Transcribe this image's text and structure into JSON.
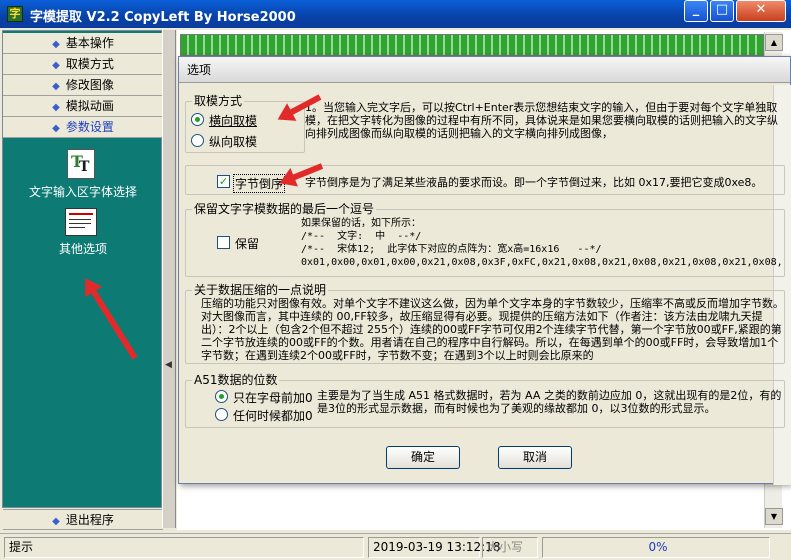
{
  "window": {
    "title": "字模提取 V2.2  CopyLeft By Horse2000",
    "icon": "app-icon"
  },
  "nav": {
    "items": [
      "基本操作",
      "取模方式",
      "修改图像",
      "模拟动画",
      "参数设置"
    ],
    "active_index": 4,
    "tools": [
      {
        "label": "文字输入区字体选择",
        "icon": "font-icon"
      },
      {
        "label": "其他选项",
        "icon": "options-icon"
      }
    ],
    "exit": "退出程序"
  },
  "dialog": {
    "title": "选项",
    "mode": {
      "title": "取模方式",
      "horizontal": "横向取模",
      "vertical": "纵向取模",
      "selected": "横向取模",
      "desc": "1。当您输入完文字后，可以按Ctrl+Enter表示您想结束文字的输入，但由于要对每个文字单独取模，在把文字转化为图像的过程中有所不同，具体说来是如果您要横向取模的话则把输入的文字纵向排列成图像而纵向取模的话则把输入的文字横向排列成图像，"
    },
    "byte_reverse": {
      "label": "字节倒序",
      "checked": true,
      "desc": "字节倒序是为了满足某些液晶的要求而设。即一个字节倒过来，比如 0x17,要把它变成0xe8。"
    },
    "keep_comma": {
      "title": "保留文字字模数据的最后一个逗号",
      "label": "保留",
      "checked": false,
      "example": "如果保留的话，如下所示：\n/*--  文字:  中  --*/\n/*--  宋体12;  此字体下对应的点阵为：宽x高=16x16   --*/\n0x01,0x00,0x01,0x00,0x21,0x08,0x3F,0xFC,0x21,0x08,0x21,0x08,0x21,0x08,0x21,0x08,"
    },
    "compress": {
      "title": "关于数据压缩的一点说明",
      "desc": "压缩的功能只对图像有效。对单个文字不建议这么做，因为单个文字本身的字节数较少，压缩率不高或反而增加字节数。对大图像而言，其中连续的 00,FF较多，故压缩显得有必要。现提供的压缩方法如下（作者注：该方法由龙啸九天提出）：2个以上（包含2个但不超过 255个）连续的00或FF字节可仅用2个连续字节代替，第一个字节放00或FF,紧跟的第二个字节放连续的00或FF的个数。用者请在自己的程序中自行解码。所以，在每遇到单个的00或FF时，会导致增加1个字节数；在遇到连续2个00或FF时，字节数不变；在遇到3个以上时则会比原来的"
    },
    "a51": {
      "title": "A51数据的位数",
      "opt1": "只在字母前加0",
      "opt2": "任何时候都加0",
      "selected": "只在字母前加0",
      "desc": "主要是为了当生成 A51 格式数据时，若为 AA 之类的数前边应加 0，这就出现有的是2位，有的是3位的形式显示数据，而有时候也为了美观的缘故都加 0，以3位数的形式显示。"
    },
    "ok": "确定",
    "cancel": "取消"
  },
  "status": {
    "hint": "提示",
    "datetime": "2019-03-19 13:12:18",
    "caps": "大小写",
    "progress": "0%"
  },
  "colors": {
    "teal": "#0d7a74",
    "title_blue": "#0a5fd8",
    "arrow_red": "#e22a2a",
    "radio_green": "#21a121"
  }
}
